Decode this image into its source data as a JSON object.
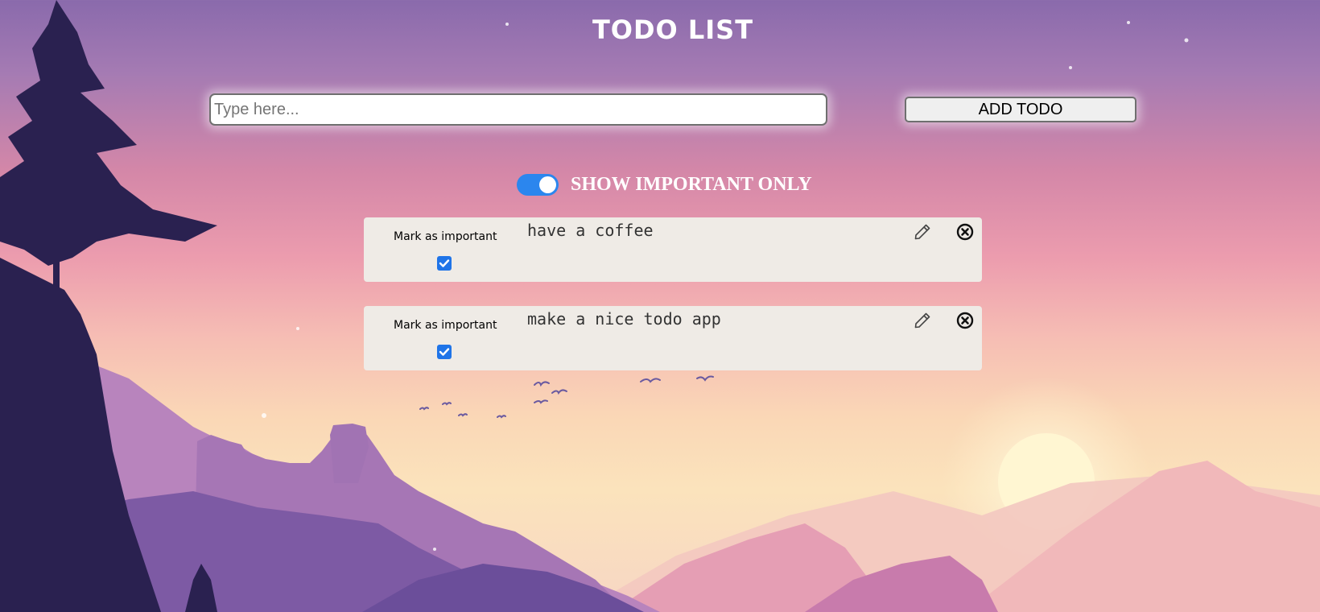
{
  "app": {
    "title": "TODO LIST"
  },
  "input": {
    "placeholder": "Type here...",
    "value": ""
  },
  "add_button": {
    "label": "ADD TODO"
  },
  "filter": {
    "label": "SHOW IMPORTANT ONLY",
    "enabled": true
  },
  "todos": [
    {
      "text": "have a coffee",
      "important_label": "Mark as important",
      "important": true
    },
    {
      "text": "make a nice todo app",
      "important_label": "Mark as important",
      "important": true
    }
  ],
  "icons": {
    "edit": "pencil-icon",
    "delete": "close-circle-icon",
    "checkbox": "checkmark-icon"
  },
  "colors": {
    "toggle_on": "#2b86ee",
    "checkbox": "#1f74e8",
    "card": "#efebe6",
    "title": "#ffffff"
  }
}
